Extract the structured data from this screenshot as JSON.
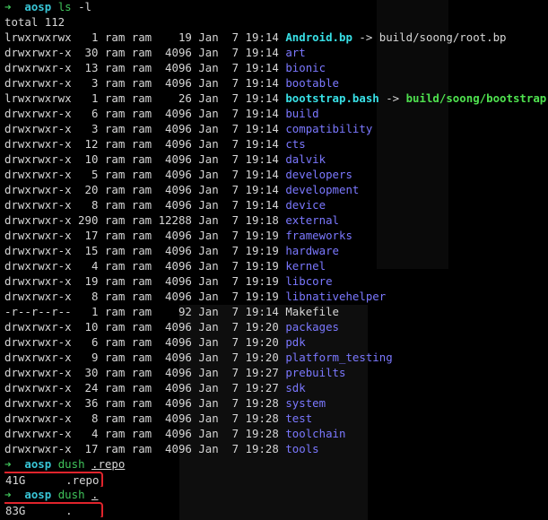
{
  "prompt": {
    "arrow": "➜",
    "cwd": "aosp"
  },
  "commands": [
    {
      "cmd": "ls",
      "arg": "-l"
    },
    {
      "cmd": "dush",
      "arg": ".repo"
    },
    {
      "cmd": "dush",
      "arg": "."
    }
  ],
  "total_line": "total 112",
  "entries": [
    {
      "perm": "lrwxrwxrwx",
      "links": "1",
      "owner": "ram",
      "group": "ram",
      "size": "19",
      "month": "Jan",
      "day": "7",
      "time": "19:14",
      "name": "Android.bp",
      "kind": "link",
      "target": "build/soong/root.bp",
      "target_kind": "plain"
    },
    {
      "perm": "drwxrwxr-x",
      "links": "30",
      "owner": "ram",
      "group": "ram",
      "size": "4096",
      "month": "Jan",
      "day": "7",
      "time": "19:14",
      "name": "art",
      "kind": "dir"
    },
    {
      "perm": "drwxrwxr-x",
      "links": "13",
      "owner": "ram",
      "group": "ram",
      "size": "4096",
      "month": "Jan",
      "day": "7",
      "time": "19:14",
      "name": "bionic",
      "kind": "dir"
    },
    {
      "perm": "drwxrwxr-x",
      "links": "3",
      "owner": "ram",
      "group": "ram",
      "size": "4096",
      "month": "Jan",
      "day": "7",
      "time": "19:14",
      "name": "bootable",
      "kind": "dir"
    },
    {
      "perm": "lrwxrwxrwx",
      "links": "1",
      "owner": "ram",
      "group": "ram",
      "size": "26",
      "month": "Jan",
      "day": "7",
      "time": "19:14",
      "name": "bootstrap.bash",
      "kind": "link",
      "target": "build/soong/bootstrap.bash",
      "target_kind": "bold"
    },
    {
      "perm": "drwxrwxr-x",
      "links": "6",
      "owner": "ram",
      "group": "ram",
      "size": "4096",
      "month": "Jan",
      "day": "7",
      "time": "19:14",
      "name": "build",
      "kind": "dir"
    },
    {
      "perm": "drwxrwxr-x",
      "links": "3",
      "owner": "ram",
      "group": "ram",
      "size": "4096",
      "month": "Jan",
      "day": "7",
      "time": "19:14",
      "name": "compatibility",
      "kind": "dir"
    },
    {
      "perm": "drwxrwxr-x",
      "links": "12",
      "owner": "ram",
      "group": "ram",
      "size": "4096",
      "month": "Jan",
      "day": "7",
      "time": "19:14",
      "name": "cts",
      "kind": "dir"
    },
    {
      "perm": "drwxrwxr-x",
      "links": "10",
      "owner": "ram",
      "group": "ram",
      "size": "4096",
      "month": "Jan",
      "day": "7",
      "time": "19:14",
      "name": "dalvik",
      "kind": "dir"
    },
    {
      "perm": "drwxrwxr-x",
      "links": "5",
      "owner": "ram",
      "group": "ram",
      "size": "4096",
      "month": "Jan",
      "day": "7",
      "time": "19:14",
      "name": "developers",
      "kind": "dir"
    },
    {
      "perm": "drwxrwxr-x",
      "links": "20",
      "owner": "ram",
      "group": "ram",
      "size": "4096",
      "month": "Jan",
      "day": "7",
      "time": "19:14",
      "name": "development",
      "kind": "dir"
    },
    {
      "perm": "drwxrwxr-x",
      "links": "8",
      "owner": "ram",
      "group": "ram",
      "size": "4096",
      "month": "Jan",
      "day": "7",
      "time": "19:14",
      "name": "device",
      "kind": "dir"
    },
    {
      "perm": "drwxrwxr-x",
      "links": "290",
      "owner": "ram",
      "group": "ram",
      "size": "12288",
      "month": "Jan",
      "day": "7",
      "time": "19:18",
      "name": "external",
      "kind": "dir"
    },
    {
      "perm": "drwxrwxr-x",
      "links": "17",
      "owner": "ram",
      "group": "ram",
      "size": "4096",
      "month": "Jan",
      "day": "7",
      "time": "19:19",
      "name": "frameworks",
      "kind": "dir"
    },
    {
      "perm": "drwxrwxr-x",
      "links": "15",
      "owner": "ram",
      "group": "ram",
      "size": "4096",
      "month": "Jan",
      "day": "7",
      "time": "19:19",
      "name": "hardware",
      "kind": "dir"
    },
    {
      "perm": "drwxrwxr-x",
      "links": "4",
      "owner": "ram",
      "group": "ram",
      "size": "4096",
      "month": "Jan",
      "day": "7",
      "time": "19:19",
      "name": "kernel",
      "kind": "dir"
    },
    {
      "perm": "drwxrwxr-x",
      "links": "19",
      "owner": "ram",
      "group": "ram",
      "size": "4096",
      "month": "Jan",
      "day": "7",
      "time": "19:19",
      "name": "libcore",
      "kind": "dir"
    },
    {
      "perm": "drwxrwxr-x",
      "links": "8",
      "owner": "ram",
      "group": "ram",
      "size": "4096",
      "month": "Jan",
      "day": "7",
      "time": "19:19",
      "name": "libnativehelper",
      "kind": "dir"
    },
    {
      "perm": "-r--r--r--",
      "links": "1",
      "owner": "ram",
      "group": "ram",
      "size": "92",
      "month": "Jan",
      "day": "7",
      "time": "19:14",
      "name": "Makefile",
      "kind": "file"
    },
    {
      "perm": "drwxrwxr-x",
      "links": "10",
      "owner": "ram",
      "group": "ram",
      "size": "4096",
      "month": "Jan",
      "day": "7",
      "time": "19:20",
      "name": "packages",
      "kind": "dir"
    },
    {
      "perm": "drwxrwxr-x",
      "links": "6",
      "owner": "ram",
      "group": "ram",
      "size": "4096",
      "month": "Jan",
      "day": "7",
      "time": "19:20",
      "name": "pdk",
      "kind": "dir"
    },
    {
      "perm": "drwxrwxr-x",
      "links": "9",
      "owner": "ram",
      "group": "ram",
      "size": "4096",
      "month": "Jan",
      "day": "7",
      "time": "19:20",
      "name": "platform_testing",
      "kind": "dir"
    },
    {
      "perm": "drwxrwxr-x",
      "links": "30",
      "owner": "ram",
      "group": "ram",
      "size": "4096",
      "month": "Jan",
      "day": "7",
      "time": "19:27",
      "name": "prebuilts",
      "kind": "dir"
    },
    {
      "perm": "drwxrwxr-x",
      "links": "24",
      "owner": "ram",
      "group": "ram",
      "size": "4096",
      "month": "Jan",
      "day": "7",
      "time": "19:27",
      "name": "sdk",
      "kind": "dir"
    },
    {
      "perm": "drwxrwxr-x",
      "links": "36",
      "owner": "ram",
      "group": "ram",
      "size": "4096",
      "month": "Jan",
      "day": "7",
      "time": "19:28",
      "name": "system",
      "kind": "dir"
    },
    {
      "perm": "drwxrwxr-x",
      "links": "8",
      "owner": "ram",
      "group": "ram",
      "size": "4096",
      "month": "Jan",
      "day": "7",
      "time": "19:28",
      "name": "test",
      "kind": "dir"
    },
    {
      "perm": "drwxrwxr-x",
      "links": "4",
      "owner": "ram",
      "group": "ram",
      "size": "4096",
      "month": "Jan",
      "day": "7",
      "time": "19:28",
      "name": "toolchain",
      "kind": "dir"
    },
    {
      "perm": "drwxrwxr-x",
      "links": "17",
      "owner": "ram",
      "group": "ram",
      "size": "4096",
      "month": "Jan",
      "day": "7",
      "time": "19:28",
      "name": "tools",
      "kind": "dir"
    }
  ],
  "du_results": [
    {
      "size": "41G",
      "path": ".repo"
    },
    {
      "size": "83G",
      "path": "."
    }
  ],
  "colors": {
    "background": "#000000",
    "prompt_arrow": "#3fc35a",
    "cwd": "#38c5d6",
    "directory": "#7b78ff",
    "symlink": "#38e0e6",
    "highlight_box": "#e0242c"
  }
}
